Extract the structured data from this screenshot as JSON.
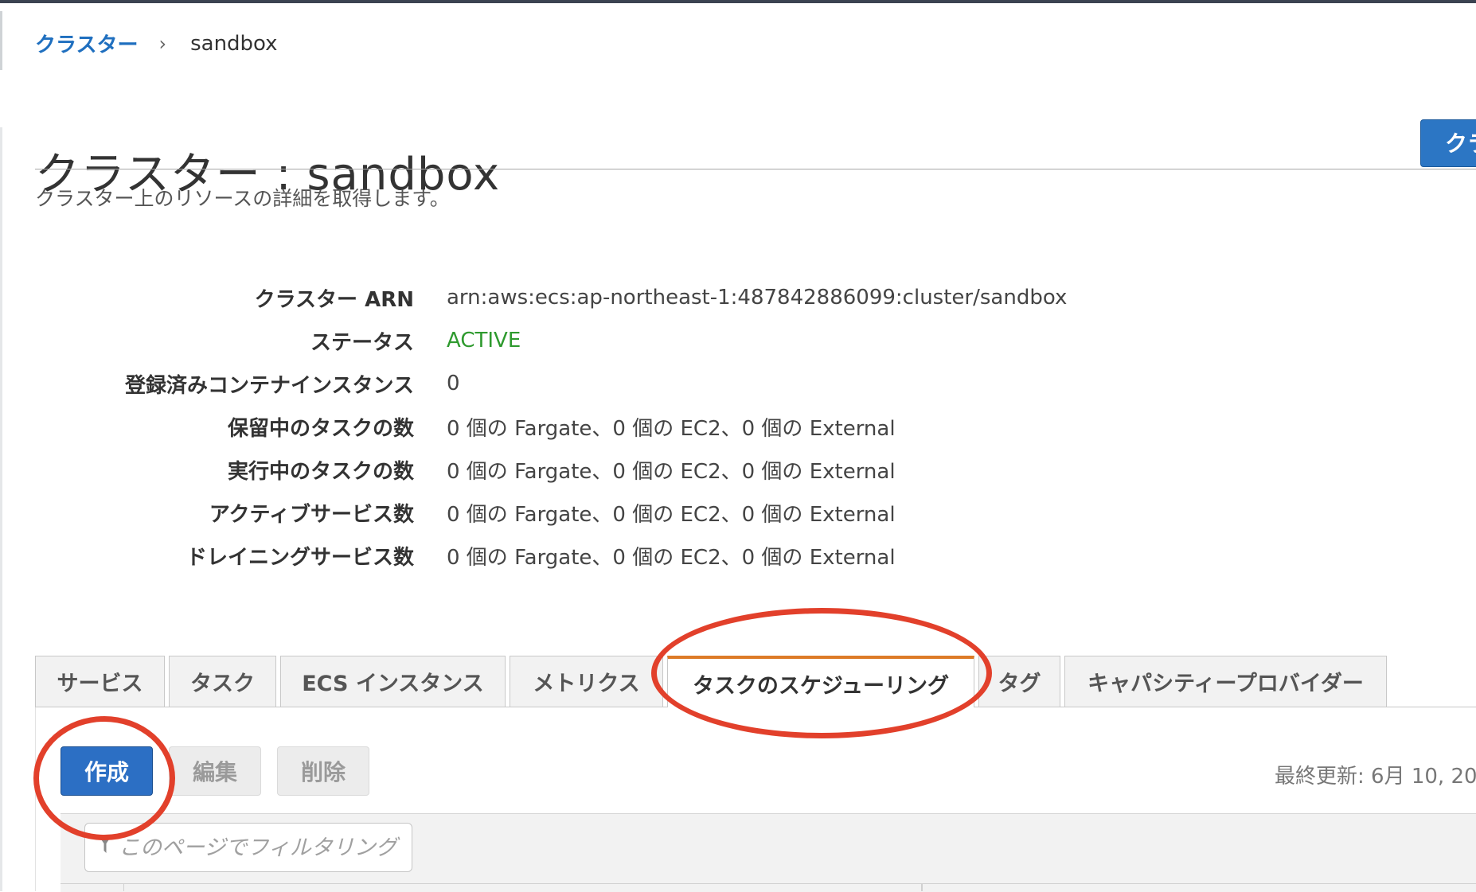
{
  "breadcrumb": {
    "parent": "クラスター",
    "separator": "›",
    "current": "sandbox"
  },
  "page": {
    "title": "クラスター : sandbox",
    "subtitle": "クラスター上のリソースの詳細を取得します。",
    "top_right_button": "クラ"
  },
  "details": [
    {
      "label": "クラスター ARN",
      "value": "arn:aws:ecs:ap-northeast-1:487842886099:cluster/sandbox"
    },
    {
      "label": "ステータス",
      "value": "ACTIVE"
    },
    {
      "label": "登録済みコンテナインスタンス",
      "value": "0"
    },
    {
      "label": "保留中のタスクの数",
      "value": "0 個の Fargate、0 個の EC2、0 個の External"
    },
    {
      "label": "実行中のタスクの数",
      "value": "0 個の Fargate、0 個の EC2、0 個の External"
    },
    {
      "label": "アクティブサービス数",
      "value": "0 個の Fargate、0 個の EC2、0 個の External"
    },
    {
      "label": "ドレイニングサービス数",
      "value": "0 個の Fargate、0 個の EC2、0 個の External"
    }
  ],
  "tabs": [
    {
      "label": "サービス"
    },
    {
      "label": "タスク"
    },
    {
      "label": "ECS インスタンス"
    },
    {
      "label": "メトリクス"
    },
    {
      "label": "タスクのスケジューリング",
      "active": true
    },
    {
      "label": "タグ"
    },
    {
      "label": "キャパシティープロバイダー"
    }
  ],
  "toolbar": {
    "create_label": "作成",
    "edit_label": "編集",
    "delete_label": "削除",
    "last_updated": "最終更新: 6月 10, 20"
  },
  "filter": {
    "placeholder": "このページでフィルタリング"
  },
  "colors": {
    "link": "#1f6fbf",
    "status_active": "#2e9a2e",
    "primary_button": "#2c6fc4",
    "active_tab_accent": "#dd7b27",
    "annotation_ring": "#e2402b"
  }
}
